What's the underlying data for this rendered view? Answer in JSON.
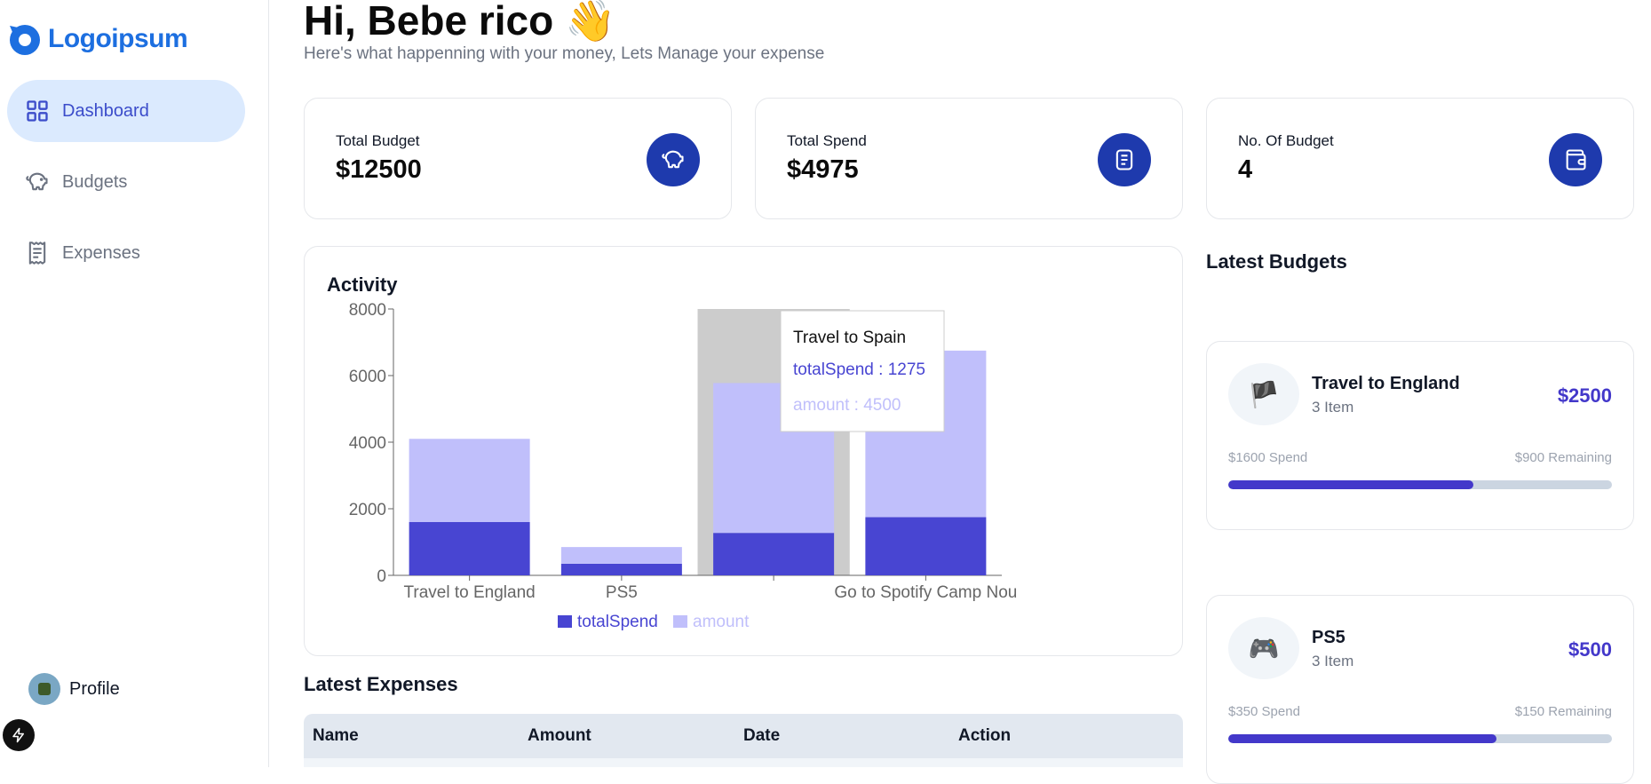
{
  "brand": {
    "name": "Logoipsum",
    "color": "#1d6fe0"
  },
  "sidebar": {
    "items": [
      {
        "label": "Dashboard",
        "icon": "grid-icon",
        "active": true
      },
      {
        "label": "Budgets",
        "icon": "piggy-bank-icon",
        "active": false
      },
      {
        "label": "Expenses",
        "icon": "receipt-icon",
        "active": false
      }
    ],
    "profile_label": "Profile"
  },
  "header": {
    "greeting": "Hi, Bebe rico 👋",
    "subtitle": "Here's what happenning with your money, Lets Manage your expense"
  },
  "stats": [
    {
      "label": "Total Budget",
      "value": "$12500",
      "icon": "piggy-bank-icon"
    },
    {
      "label": "Total Spend",
      "value": "$4975",
      "icon": "receipt-icon"
    },
    {
      "label": "No. Of Budget",
      "value": "4",
      "icon": "wallet-icon"
    }
  ],
  "activity": {
    "title": "Activity",
    "tooltip": {
      "title": "Travel to Spain",
      "spend_line": "totalSpend : 1275",
      "amount_line": "amount : 4500"
    }
  },
  "chart_data": {
    "type": "bar",
    "stacked": true,
    "categories": [
      "Travel to England",
      "PS5",
      "Travel to Spain",
      "Go to Spotify Camp Nou"
    ],
    "tick_labels_shown": [
      "Travel to England",
      "PS5",
      "",
      "Go to Spotify Camp Nou"
    ],
    "series": [
      {
        "name": "totalSpend",
        "values": [
          1600,
          350,
          1275,
          1750
        ],
        "color": "#4845d2"
      },
      {
        "name": "amount",
        "values": [
          2500,
          500,
          4500,
          5000
        ],
        "color": "#c0bffb"
      }
    ],
    "yticks": [
      0,
      2000,
      4000,
      6000,
      8000
    ],
    "ylim": [
      0,
      8000
    ],
    "highlighted_category": "Travel to Spain",
    "legend": "bottom"
  },
  "latest_expenses": {
    "title": "Latest Expenses",
    "columns": [
      "Name",
      "Amount",
      "Date",
      "Action"
    ]
  },
  "latest_budgets": {
    "title": "Latest Budgets",
    "items": [
      {
        "emoji": "🏴",
        "name": "Travel to England",
        "items": "3 Item",
        "amount": "$2500",
        "spend": "$1600 Spend",
        "remaining": "$900 Remaining",
        "progress": 0.64
      },
      {
        "emoji": "🎮",
        "name": "PS5",
        "items": "3 Item",
        "amount": "$500",
        "spend": "$350 Spend",
        "remaining": "$150 Remaining",
        "progress": 0.7
      }
    ]
  }
}
